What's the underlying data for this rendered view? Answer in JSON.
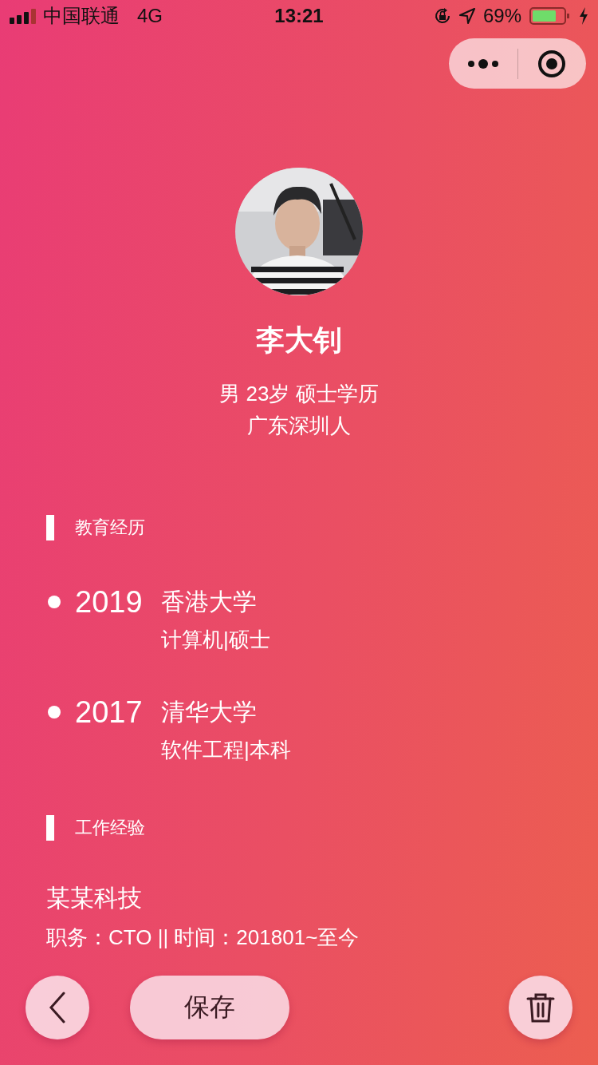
{
  "status_bar": {
    "carrier": "中国联通",
    "network": "4G",
    "time": "13:21",
    "battery": "69%"
  },
  "profile": {
    "name": "李大钊",
    "details": [
      "男 23岁 硕士学历",
      "广东深圳人"
    ]
  },
  "education": {
    "title": "教育经历",
    "entries": [
      {
        "year": "2019",
        "school": "香港大学",
        "major": "计算机|硕士"
      },
      {
        "year": "2017",
        "school": "清华大学",
        "major": "软件工程|本科"
      }
    ]
  },
  "work": {
    "title": "工作经验",
    "entries": [
      {
        "company": "某某科技",
        "detail": "职务：CTO || 时间：201801~至今"
      }
    ]
  },
  "actions": {
    "save": "保存"
  }
}
